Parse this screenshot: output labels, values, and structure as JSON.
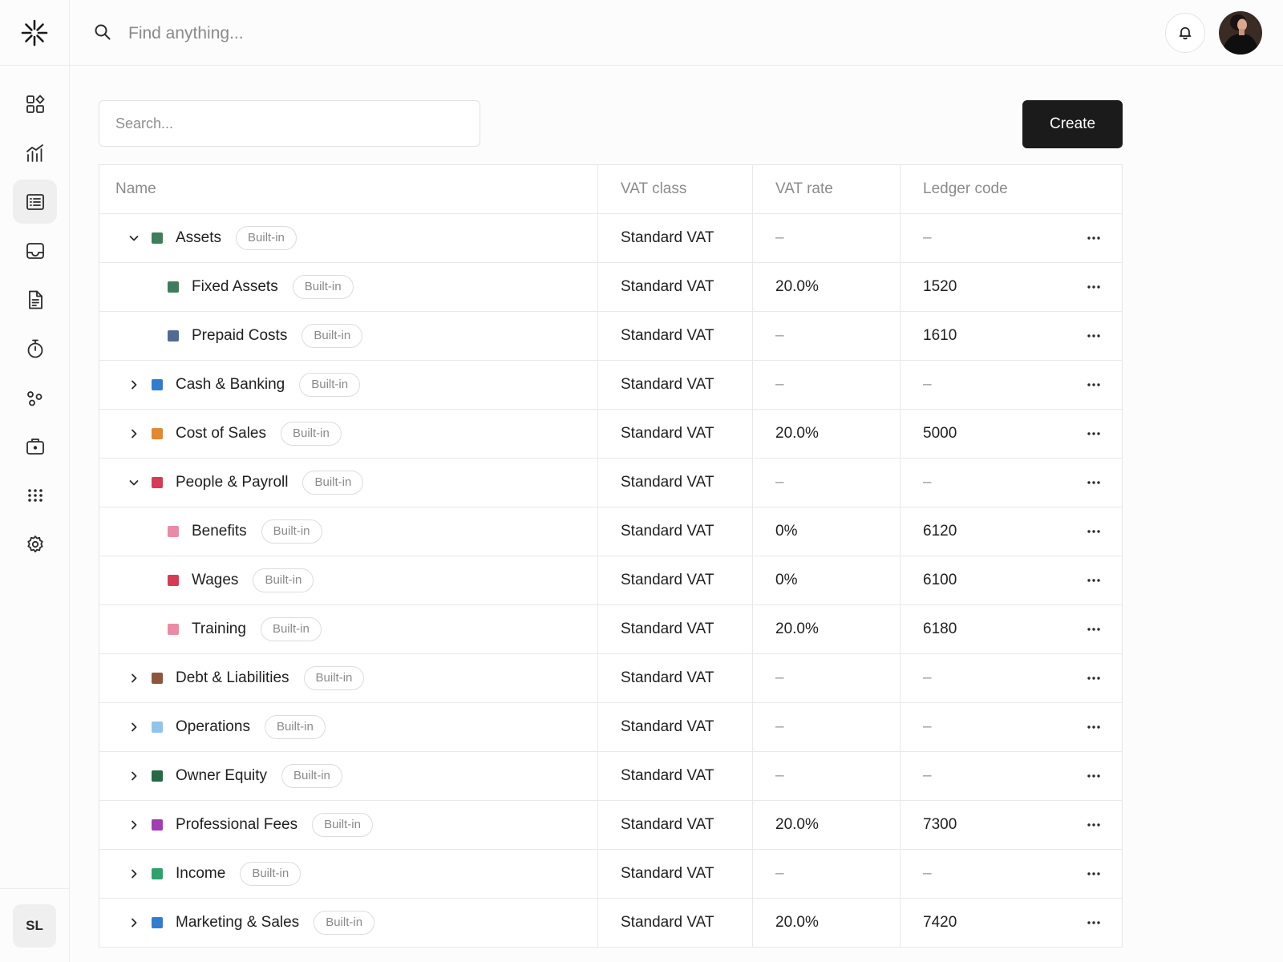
{
  "topbar": {
    "search_placeholder": "Find anything..."
  },
  "sidebar": {
    "items": [
      {
        "name": "dashboard",
        "icon": "grid-icon",
        "active": false
      },
      {
        "name": "reports",
        "icon": "bar-chart-icon",
        "active": false
      },
      {
        "name": "ledger",
        "icon": "list-icon",
        "active": true
      },
      {
        "name": "inbox",
        "icon": "inbox-icon",
        "active": false
      },
      {
        "name": "documents",
        "icon": "document-icon",
        "active": false
      },
      {
        "name": "timer",
        "icon": "stopwatch-icon",
        "active": false
      },
      {
        "name": "integrations",
        "icon": "nodes-icon",
        "active": false
      },
      {
        "name": "vault",
        "icon": "briefcase-icon",
        "active": false
      },
      {
        "name": "apps",
        "icon": "apps-icon",
        "active": false
      },
      {
        "name": "settings",
        "icon": "gear-icon",
        "active": false
      }
    ],
    "user_initials": "SL"
  },
  "toolbar": {
    "search_placeholder": "Search...",
    "create_label": "Create"
  },
  "table": {
    "headers": {
      "name": "Name",
      "vat_class": "VAT class",
      "vat_rate": "VAT rate",
      "ledger_code": "Ledger code"
    },
    "rows": [
      {
        "name": "Assets",
        "badge": "Built-in",
        "color": "#3f7d5c",
        "level": 0,
        "expander": "expanded",
        "vat_class": "Standard VAT",
        "vat_rate": "–",
        "ledger_code": "–"
      },
      {
        "name": "Fixed Assets",
        "badge": "Built-in",
        "color": "#3f7d5c",
        "level": 1,
        "expander": "none",
        "vat_class": "Standard VAT",
        "vat_rate": "20.0%",
        "ledger_code": "1520"
      },
      {
        "name": "Prepaid Costs",
        "badge": "Built-in",
        "color": "#4f6b93",
        "level": 1,
        "expander": "none",
        "vat_class": "Standard VAT",
        "vat_rate": "–",
        "ledger_code": "1610"
      },
      {
        "name": "Cash & Banking",
        "badge": "Built-in",
        "color": "#2f7dd1",
        "level": 0,
        "expander": "collapsed",
        "vat_class": "Standard VAT",
        "vat_rate": "–",
        "ledger_code": "–"
      },
      {
        "name": "Cost of Sales",
        "badge": "Built-in",
        "color": "#e0892e",
        "level": 0,
        "expander": "collapsed",
        "vat_class": "Standard VAT",
        "vat_rate": "20.0%",
        "ledger_code": "5000"
      },
      {
        "name": "People & Payroll",
        "badge": "Built-in",
        "color": "#d63a56",
        "level": 0,
        "expander": "expanded",
        "vat_class": "Standard VAT",
        "vat_rate": "–",
        "ledger_code": "–"
      },
      {
        "name": "Benefits",
        "badge": "Built-in",
        "color": "#eb8aa5",
        "level": 1,
        "expander": "none",
        "vat_class": "Standard VAT",
        "vat_rate": "0%",
        "ledger_code": "6120"
      },
      {
        "name": "Wages",
        "badge": "Built-in",
        "color": "#d63a56",
        "level": 1,
        "expander": "none",
        "vat_class": "Standard VAT",
        "vat_rate": "0%",
        "ledger_code": "6100"
      },
      {
        "name": "Training",
        "badge": "Built-in",
        "color": "#eb8aa5",
        "level": 1,
        "expander": "none",
        "vat_class": "Standard VAT",
        "vat_rate": "20.0%",
        "ledger_code": "6180"
      },
      {
        "name": "Debt & Liabilities",
        "badge": "Built-in",
        "color": "#8c5540",
        "level": 0,
        "expander": "collapsed",
        "vat_class": "Standard VAT",
        "vat_rate": "–",
        "ledger_code": "–"
      },
      {
        "name": "Operations",
        "badge": "Built-in",
        "color": "#90c4ec",
        "level": 0,
        "expander": "collapsed",
        "vat_class": "Standard VAT",
        "vat_rate": "–",
        "ledger_code": "–"
      },
      {
        "name": "Owner Equity",
        "badge": "Built-in",
        "color": "#256a45",
        "level": 0,
        "expander": "collapsed",
        "vat_class": "Standard VAT",
        "vat_rate": "–",
        "ledger_code": "–"
      },
      {
        "name": "Professional Fees",
        "badge": "Built-in",
        "color": "#a23db4",
        "level": 0,
        "expander": "collapsed",
        "vat_class": "Standard VAT",
        "vat_rate": "20.0%",
        "ledger_code": "7300"
      },
      {
        "name": "Income",
        "badge": "Built-in",
        "color": "#2aa36d",
        "level": 0,
        "expander": "collapsed",
        "vat_class": "Standard VAT",
        "vat_rate": "–",
        "ledger_code": "–"
      },
      {
        "name": "Marketing & Sales",
        "badge": "Built-in",
        "color": "#2f7dd1",
        "level": 0,
        "expander": "collapsed",
        "vat_class": "Standard VAT",
        "vat_rate": "20.0%",
        "ledger_code": "7420"
      }
    ]
  }
}
